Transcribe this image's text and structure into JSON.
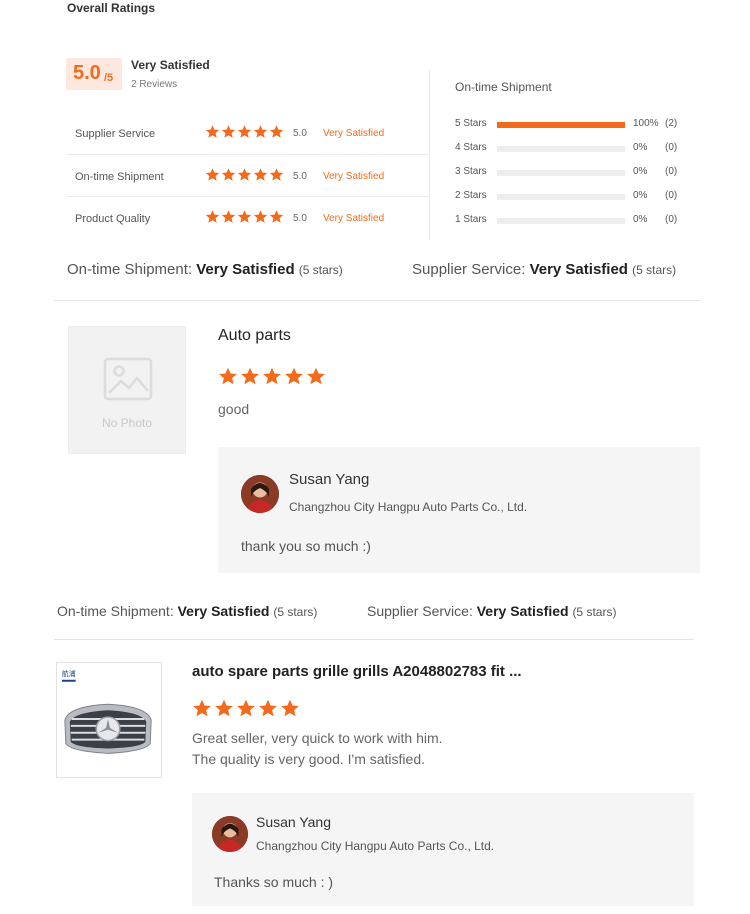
{
  "overall": {
    "title": "Overall Ratings",
    "score": "5.0",
    "score_suffix": "/5",
    "level": "Very Satisfied",
    "reviews": "2 Reviews",
    "accent_color": "#f26b1d",
    "categories": [
      {
        "label": "Supplier Service",
        "stars": 5,
        "score": "5.0",
        "level": "Very Satisfied"
      },
      {
        "label": "On-time Shipment",
        "stars": 5,
        "score": "5.0",
        "level": "Very Satisfied"
      },
      {
        "label": "Product Quality",
        "stars": 5,
        "score": "5.0",
        "level": "Very Satisfied"
      }
    ]
  },
  "distribution": {
    "title": "On-time Shipment",
    "rows": [
      {
        "label": "5 Stars",
        "fraction": 1.0,
        "pct": "100%",
        "count": "(2)"
      },
      {
        "label": "4 Stars",
        "fraction": 0,
        "pct": "0%",
        "count": "(0)"
      },
      {
        "label": "3 Stars",
        "fraction": 0,
        "pct": "0%",
        "count": "(0)"
      },
      {
        "label": "2 Stars",
        "fraction": 0,
        "pct": "0%",
        "count": "(0)"
      },
      {
        "label": "1 Stars",
        "fraction": 0,
        "pct": "0%",
        "count": "(0)"
      }
    ]
  },
  "reviews": [
    {
      "summary": {
        "shipment_label": "On-time Shipment:",
        "shipment_value": "Very Satisfied",
        "shipment_stars": "(5 stars)",
        "service_label": "Supplier Service:",
        "service_value": "Very Satisfied",
        "service_stars": "(5 stars)"
      },
      "photo_placeholder": "No Photo",
      "title": "Auto parts",
      "stars": 5,
      "body": [
        "good"
      ],
      "reply": {
        "name": "Susan Yang",
        "company": "Changzhou City Hangpu Auto Parts Co., Ltd.",
        "text": "thank you so much :)"
      }
    },
    {
      "summary": {
        "shipment_label": "On-time Shipment:",
        "shipment_value": "Very Satisfied",
        "shipment_stars": "(5 stars)",
        "service_label": "Supplier Service:",
        "service_value": "Very Satisfied",
        "service_stars": "(5 stars)"
      },
      "title": "auto spare parts grille grills A2048802783 fit ...",
      "stars": 5,
      "body": [
        "Great seller, very quick to work with him.",
        "The quality is very good. I'm satisfied."
      ],
      "reply": {
        "name": "Susan Yang",
        "company": "Changzhou City Hangpu Auto Parts Co., Ltd.",
        "text": "Thanks so much : )"
      }
    }
  ]
}
